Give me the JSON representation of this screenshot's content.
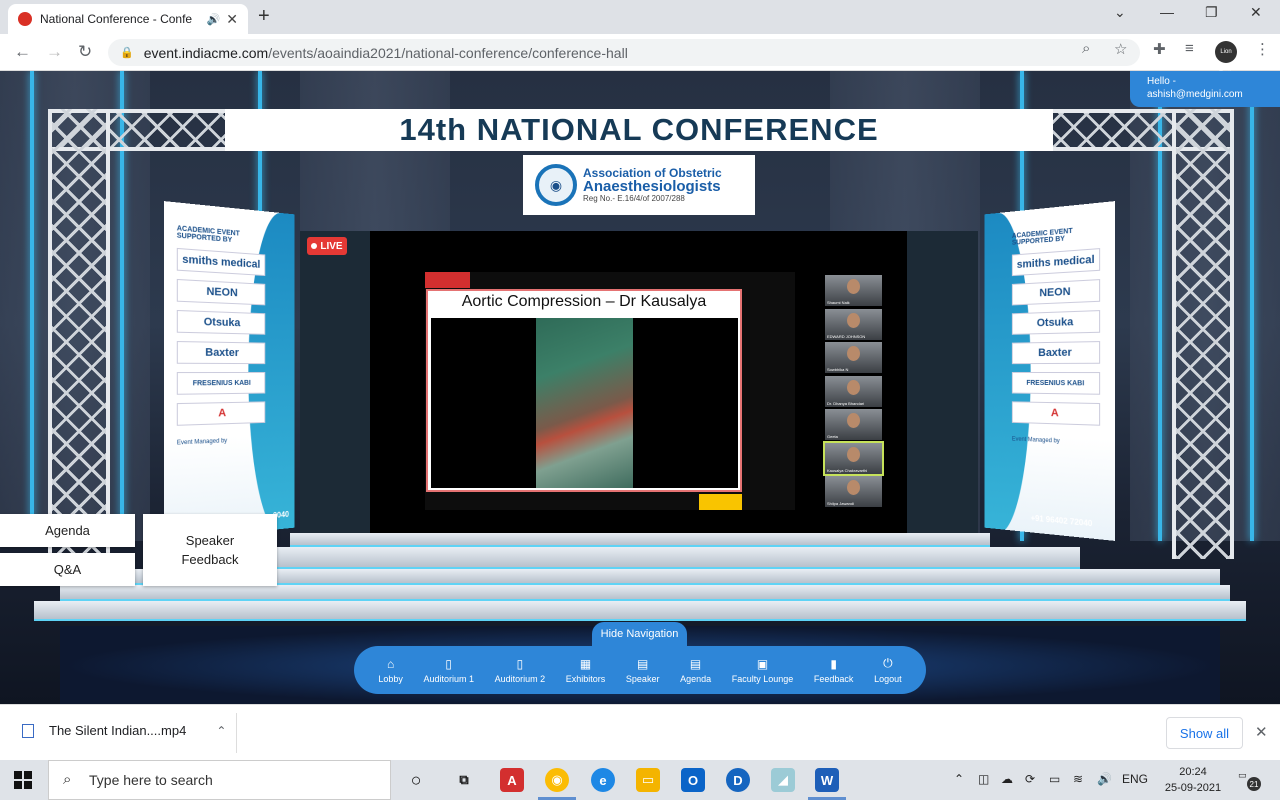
{
  "browser": {
    "tab_title": "National Conference - Confe",
    "new_tab_symbol": "+",
    "url_host": "event.indiacme.com",
    "url_path": "/events/aoaindia2021/national-conference/conference-hall",
    "profile_label": "Lion Truth"
  },
  "page": {
    "hello_line1": "Hello -",
    "hello_line2": "ashish@medgini.com",
    "banner_title": "14th NATIONAL CONFERENCE",
    "org_logo_line1": "Association of Obstetric",
    "org_logo_line2": "Anaesthesiologists",
    "org_logo_line3": "Reg No.- E.16/4/of 2007/288",
    "left_banner": {
      "header": "ACADEMIC EVENT SUPPORTED BY",
      "sponsors": [
        "smiths medical",
        "NEON",
        "Otsuka",
        "Baxter",
        "FRESENIUS KABI",
        "A"
      ],
      "managed_by": "Event Managed by",
      "phone": "2040"
    },
    "right_banner": {
      "header": "ACADEMIC EVENT SUPPORTED BY",
      "sponsors": [
        "smiths medical",
        "NEON",
        "Otsuka",
        "Baxter",
        "FRESENIUS KABI",
        "A"
      ],
      "managed_by": "Event Managed by",
      "phone": "+91 96402 72040"
    },
    "live_label": "LIVE",
    "slide_title": "Aortic Compression – Dr Kausalya",
    "participants": [
      {
        "name": "Shaumi Naik"
      },
      {
        "name": "EDWARD JOHNSON"
      },
      {
        "name": "Sowbhika N"
      },
      {
        "name": "Dr. Dhanya Bhandari"
      },
      {
        "name": "Geeta"
      },
      {
        "name": "Kausalya Chakravarthi"
      },
      {
        "name": "Shilpa Jawandi"
      }
    ],
    "side_buttons": {
      "agenda": "Agenda",
      "qa": "Q&A",
      "speaker_feedback_line1": "Speaker",
      "speaker_feedback_line2": "Feedback"
    },
    "hide_navigation": "Hide Navigation",
    "nav": [
      {
        "label": "Lobby",
        "icon": "home-icon"
      },
      {
        "label": "Auditorium 1",
        "icon": "door-icon"
      },
      {
        "label": "Auditorium 2",
        "icon": "door-icon"
      },
      {
        "label": "Exhibitors",
        "icon": "grid-icon"
      },
      {
        "label": "Speaker",
        "icon": "document-icon"
      },
      {
        "label": "Agenda",
        "icon": "document-icon"
      },
      {
        "label": "Faculty Lounge",
        "icon": "monitor-icon"
      },
      {
        "label": "Feedback",
        "icon": "comment-icon"
      },
      {
        "label": "Logout",
        "icon": "power-icon"
      }
    ]
  },
  "download_shelf": {
    "file_name": "The Silent Indian....mp4",
    "show_all": "Show all"
  },
  "taskbar": {
    "search_placeholder": "Type here to search",
    "language": "ENG",
    "time": "20:24",
    "date": "25-09-2021",
    "notification_count": "21"
  },
  "colors": {
    "accent_blue": "#2e86d8",
    "live_red": "#e53935",
    "banner_text": "#163a56"
  }
}
